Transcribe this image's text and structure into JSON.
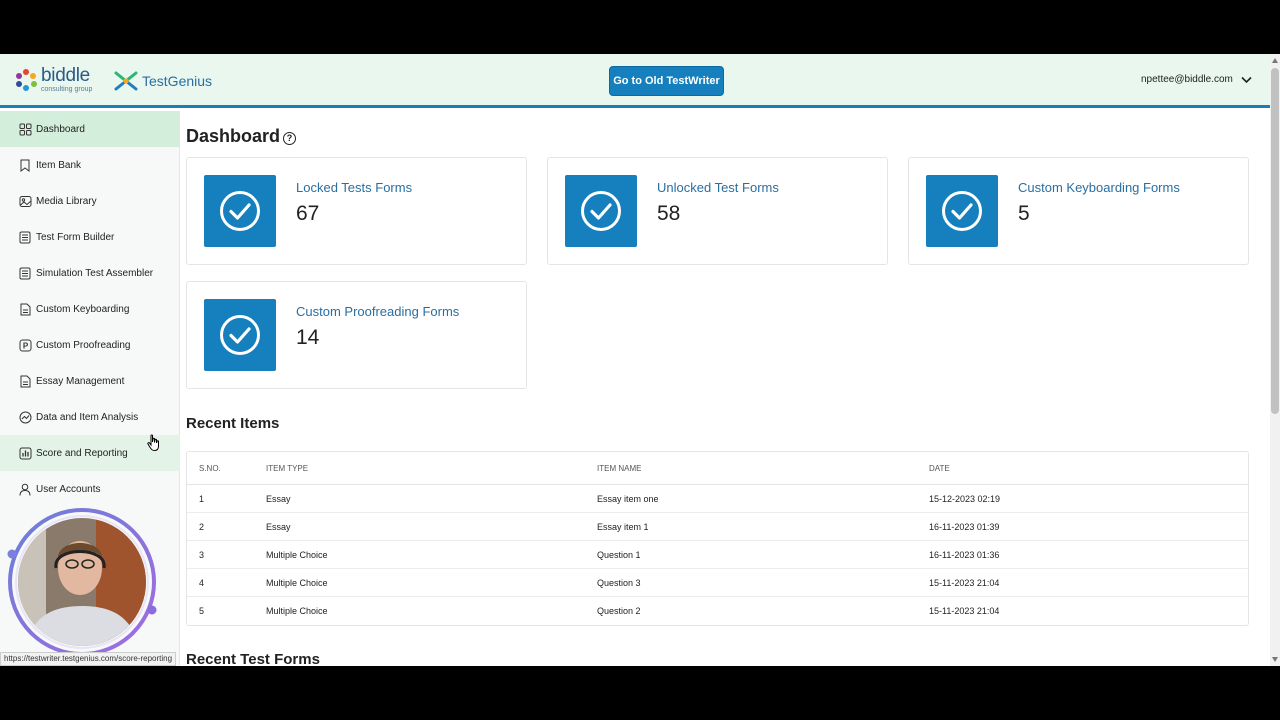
{
  "header": {
    "brand_name": "biddle",
    "brand_sub": "consulting group",
    "product_name": "TestGenius",
    "old_button_label": "Go to Old TestWriter",
    "user_email": "npettee@biddle.com"
  },
  "sidebar": {
    "items": [
      {
        "label": "Dashboard",
        "icon": "grid-icon"
      },
      {
        "label": "Item Bank",
        "icon": "bookmark-icon"
      },
      {
        "label": "Media Library",
        "icon": "image-icon"
      },
      {
        "label": "Test Form Builder",
        "icon": "list-icon"
      },
      {
        "label": "Simulation Test Assembler",
        "icon": "list-icon"
      },
      {
        "label": "Custom Keyboarding",
        "icon": "document-icon"
      },
      {
        "label": "Custom Proofreading",
        "icon": "p-box-icon"
      },
      {
        "label": "Essay Management",
        "icon": "document-icon"
      },
      {
        "label": "Data and Item Analysis",
        "icon": "analytics-icon"
      },
      {
        "label": "Score and Reporting",
        "icon": "bar-chart-icon"
      },
      {
        "label": "User Accounts",
        "icon": "user-icon"
      }
    ],
    "status_url": "https://testwriter.testgenius.com/score-reporting"
  },
  "main": {
    "title": "Dashboard",
    "help_glyph": "?",
    "cards": [
      {
        "label": "Locked Tests Forms",
        "value": "67"
      },
      {
        "label": "Unlocked Test Forms",
        "value": "58"
      },
      {
        "label": "Custom Keyboarding Forms",
        "value": "5"
      },
      {
        "label": "Custom Proofreading Forms",
        "value": "14"
      }
    ],
    "recent_items_title": "Recent Items",
    "recent_items": {
      "headers": [
        "S.NO.",
        "ITEM TYPE",
        "ITEM NAME",
        "DATE"
      ],
      "rows": [
        [
          "1",
          "Essay",
          "Essay item one",
          "15-12-2023 02:19"
        ],
        [
          "2",
          "Essay",
          "Essay item 1",
          "16-11-2023 01:39"
        ],
        [
          "3",
          "Multiple Choice",
          "Question 1",
          "16-11-2023 01:36"
        ],
        [
          "4",
          "Multiple Choice",
          "Question 3",
          "15-11-2023 21:04"
        ],
        [
          "5",
          "Multiple Choice",
          "Question 2",
          "15-11-2023 21:04"
        ]
      ]
    },
    "recent_forms_title": "Recent Test Forms"
  },
  "colors": {
    "accent": "#1580bd",
    "header_bg": "#e9f7ee",
    "active_nav": "#d3efdb"
  }
}
